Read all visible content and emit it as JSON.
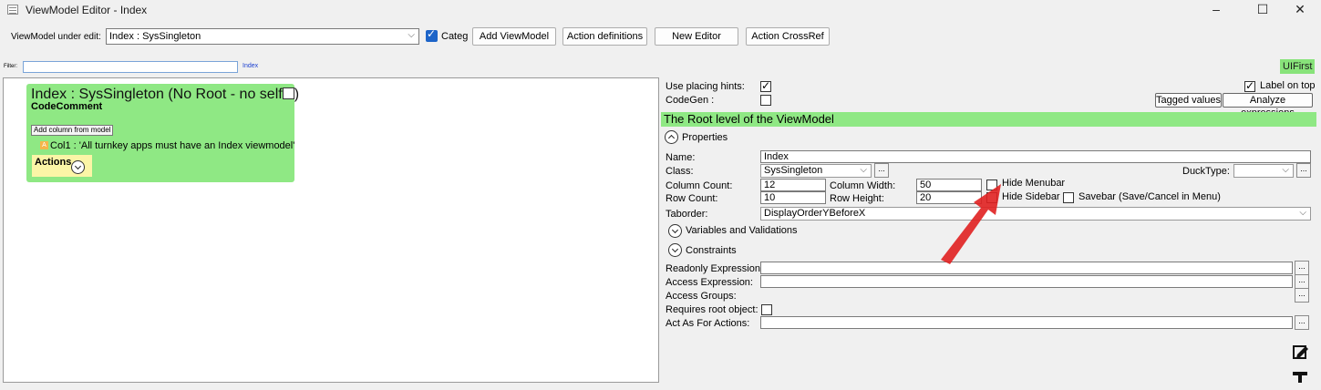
{
  "window": {
    "title": "ViewModel Editor - Index",
    "minimize": "–",
    "maximize": "☐",
    "close": "✕"
  },
  "toolbar": {
    "vm_label": "ViewModel under edit:",
    "vm_value": "Index : SysSingleton",
    "categ_label": "Categ",
    "add_viewmodel": "Add ViewModel",
    "action_definitions": "Action definitions",
    "new_editor": "New Editor",
    "action_crossref": "Action CrossRef"
  },
  "filter": {
    "label": "Filter:",
    "value": "",
    "hint": "Index"
  },
  "uifirst": "UIFirst",
  "card": {
    "title": "Index : SysSingleton  (No Root - no self",
    "title_end": ")",
    "code_comment": "CodeComment",
    "add_column_btn": "Add column from model",
    "col_badge": "A",
    "column": "Col1 : 'All turnkey apps must have an Index viewmodel'",
    "actions": "Actions"
  },
  "hints": {
    "use_placing_hints": "Use placing hints:",
    "codegen": "CodeGen :",
    "label_on_top": "Label on top",
    "tagged_values": "Tagged values",
    "analyze_expressions": "Analyze expressions"
  },
  "root_header": "The Root level of the ViewModel",
  "properties": {
    "section": "Properties",
    "name_label": "Name:",
    "name_value": "Index",
    "class_label": "Class:",
    "class_value": "SysSingleton",
    "ducktype_label": "DuckType:",
    "column_count_label": "Column Count:",
    "column_count": "12",
    "column_width_label": "Column Width:",
    "column_width": "50",
    "hide_menubar": "Hide Menubar",
    "row_count_label": "Row Count:",
    "row_count": "10",
    "row_height_label": "Row Height:",
    "row_height": "20",
    "hide_sidebar": "Hide Sidebar",
    "savebar": "Savebar (Save/Cancel in Menu)",
    "taborder_label": "Taborder:",
    "taborder_value": "DisplayOrderYBeforeX"
  },
  "sections": {
    "variables": "Variables and Validations",
    "constraints": "Constraints"
  },
  "constraints": {
    "readonly_expression": "Readonly Expression:",
    "access_expression": "Access Expression:",
    "access_groups": "Access Groups:",
    "requires_root": "Requires root object:",
    "act_as_for_actions": "Act As For Actions:"
  },
  "dots_label": "...",
  "colors": {
    "green": "#8fe884",
    "yellow": "#fbf5a6",
    "accent_blue": "#1c64c8",
    "arrow_red": "#e02020"
  }
}
